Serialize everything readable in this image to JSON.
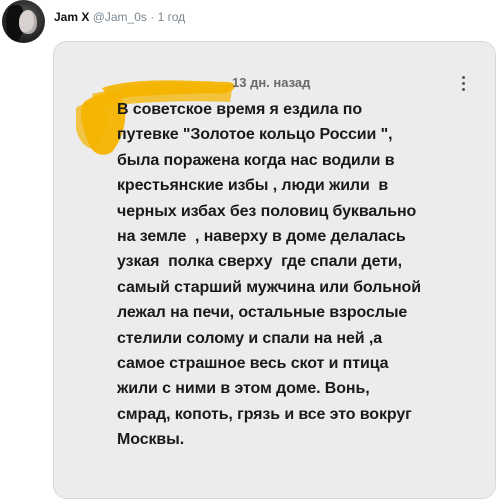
{
  "tweet": {
    "author_name": "Jam X",
    "author_handle": "@Jam_0s",
    "separator": "·",
    "timestamp": "1 год",
    "avatar_icon": "user-avatar"
  },
  "embedded_comment": {
    "author_redacted": true,
    "redaction_color": "#f5b400",
    "time_ago": "13 дн. назад",
    "menu_icon": "more-vertical-icon",
    "text_lines": [
      "В советское время я ездила по",
      "путевке \"Золотое кольцо России \",",
      "была поражена когда нас водили в",
      "крестьянские избы , люди жили  в",
      "черных избах без половиц буквально",
      "на земле  , наверху в доме делалась",
      "узкая  полка сверху  где спали дети,",
      "самый старший мужчина или больной",
      "лежал на печи, остальные взрослые",
      "стелили солому и спали на ней ,а",
      "самое страшное весь скот и птица",
      "жили с ними в этом доме. Вонь,",
      "смрад, копоть, грязь и все это вокруг",
      "Москвы."
    ]
  }
}
